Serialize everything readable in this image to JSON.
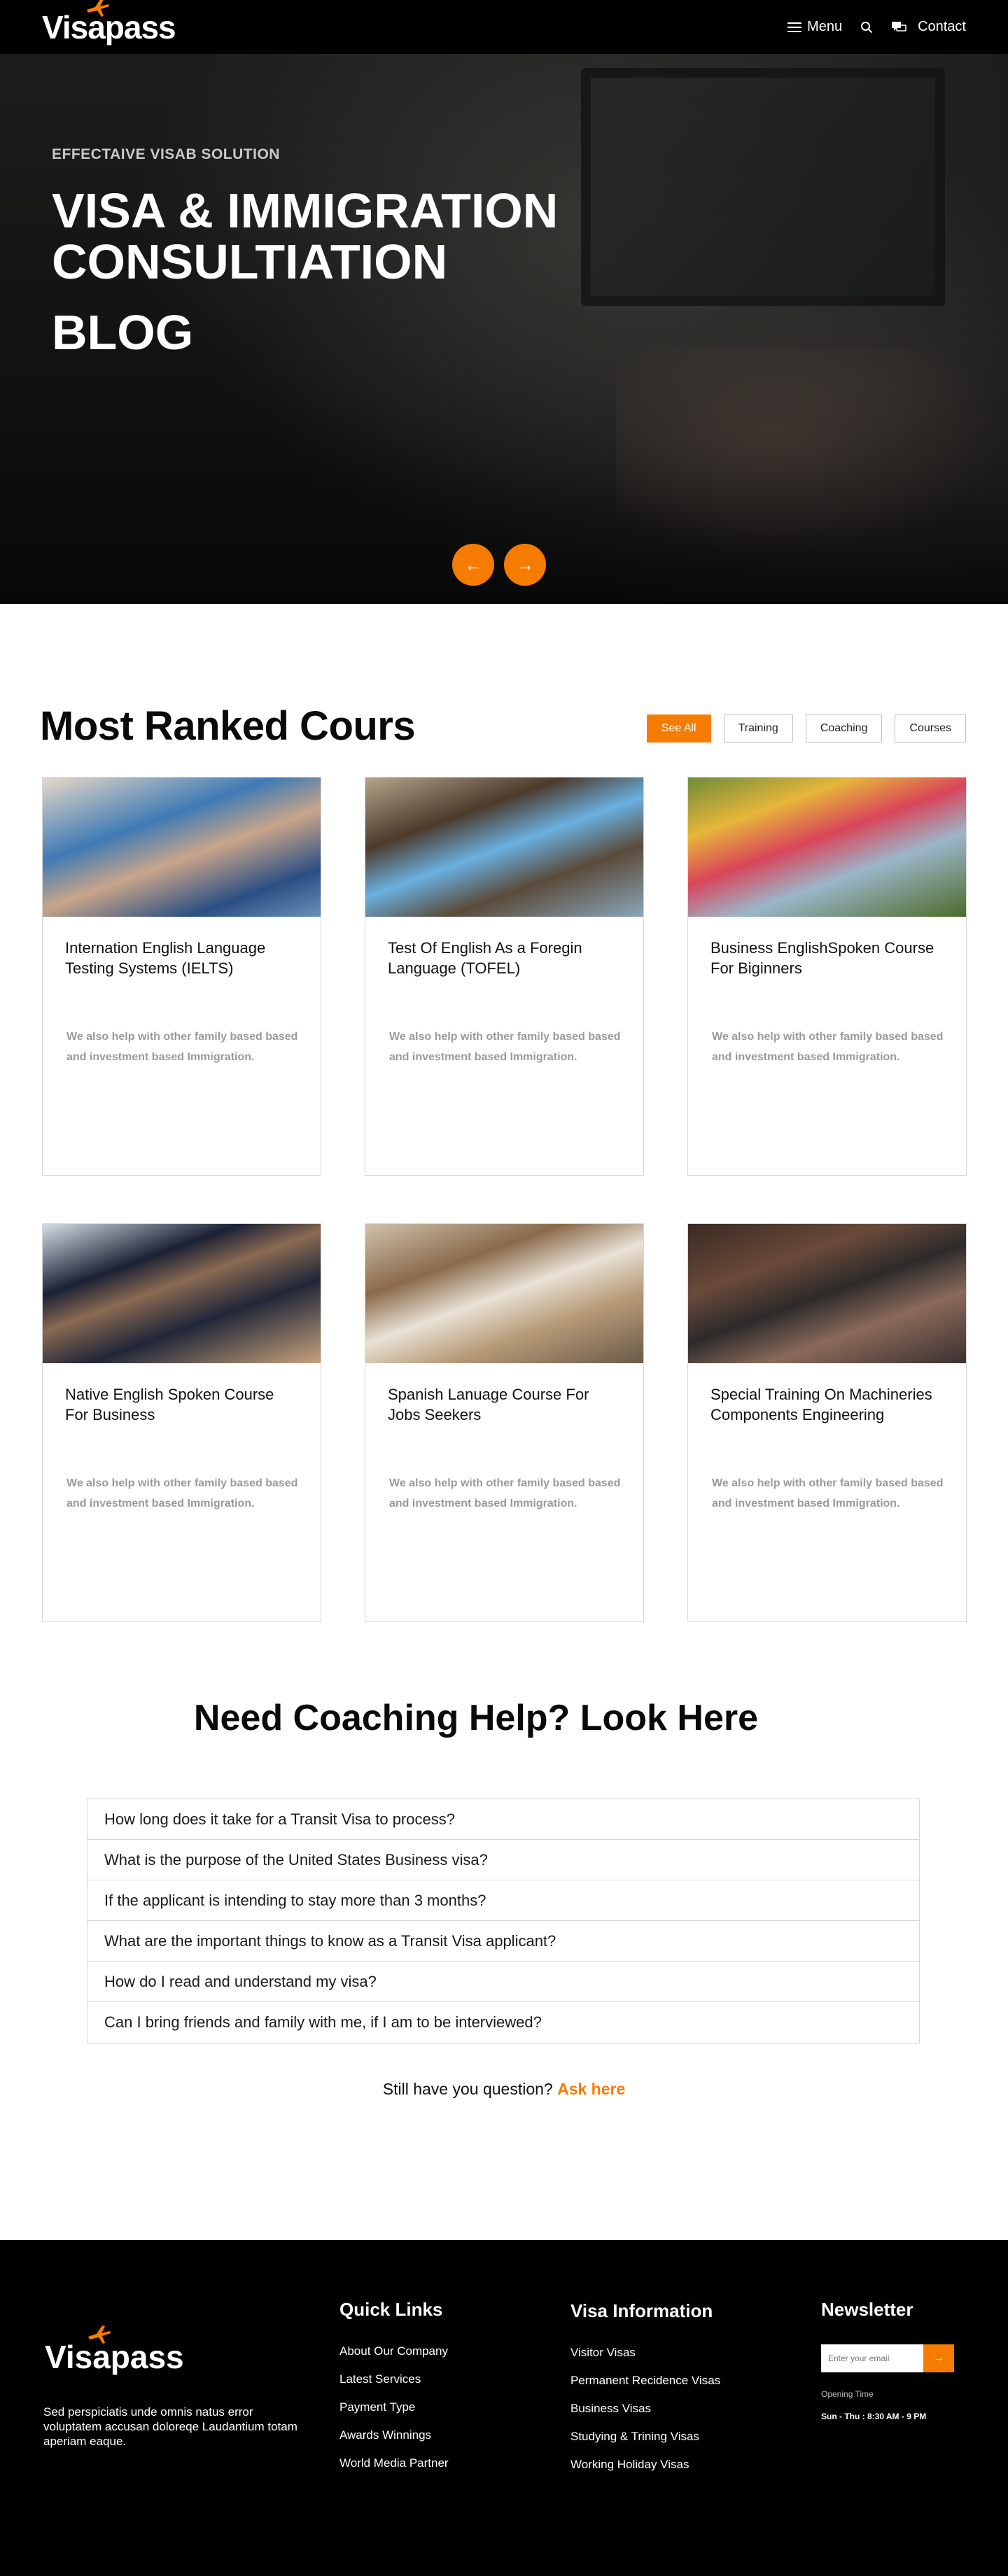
{
  "header": {
    "logo": "Visapass",
    "menu_label": "Menu",
    "contact_label": "Contact"
  },
  "hero": {
    "kicker": "EFFECTAIVE VISAB SOLUTION",
    "title": "VISA & IMMIGRATION CONSULTIATION",
    "subtitle": "BLOG",
    "prev_arrow": "←",
    "next_arrow": "→"
  },
  "courses": {
    "title": "Most Ranked Cours",
    "filters": [
      "See All",
      "Training",
      "Coaching",
      "Courses"
    ],
    "cards": [
      {
        "title": "Internation English Language Testing Systems (IELTS)",
        "desc": "We also help with other family based based and investment based Immigration.",
        "image": "student-nurses-photo"
      },
      {
        "title": "Test Of English As a Foregin Language (TOFEL)",
        "desc": "We also help with other family based based and investment based Immigration.",
        "image": "smiling-student-photo"
      },
      {
        "title": "Business EnglishSpoken Course For Biginners",
        "desc": "We also help with other family based based and investment based Immigration.",
        "image": "student-group-photo"
      },
      {
        "title": "Native English Spoken Course For Business",
        "desc": "We also help with other family based based and investment based Immigration.",
        "image": "graduates-photo"
      },
      {
        "title": "Spanish Lanuage Course For Jobs Seekers",
        "desc": "We also help with other family based based and investment based Immigration.",
        "image": "classroom-photo"
      },
      {
        "title": "Special Training On Machineries Components Engineering",
        "desc": "We also help with other family based based and investment based Immigration.",
        "image": "lecture-hall-photo"
      }
    ]
  },
  "faq": {
    "title": "Need Coaching Help? Look Here",
    "items": [
      "How long does it take for a Transit Visa to process?",
      "What is the purpose of the United States Business visa?",
      "If the applicant is intending to stay more than 3 months?",
      "What are the important things to know as a Transit Visa applicant?",
      "How do I read and understand my visa?",
      "Can I bring friends and family with me, if I am to be interviewed?"
    ],
    "still_text": "Still have you question?",
    "ask_link": "Ask here"
  },
  "footer": {
    "logo": "Visapass",
    "about": "Sed perspiciatis unde omnis natus error voluptatem accusan doloreqe Laudantium totam aperiam eaque.",
    "quick_links_title": "Quick Links",
    "quick_links": [
      "About Our Company",
      "Latest Services",
      "Payment Type",
      "Awards Winnings",
      "World Media Partner"
    ],
    "visa_title": "Visa Information",
    "visa_links": [
      "Visitor Visas",
      "Permanent Recidence Visas",
      "Business Visas",
      "Studying & Trining Visas",
      "Working Holiday Visas"
    ],
    "newsletter_title": "Newsletter",
    "email_placeholder": "Enter your email",
    "submit_arrow": "→",
    "opening_label": "Opening Time",
    "opening_hours": "Sun - Thu : 8:30 AM - 9 PM"
  },
  "colors": {
    "accent": "#f57c00",
    "dark": "#000000"
  }
}
